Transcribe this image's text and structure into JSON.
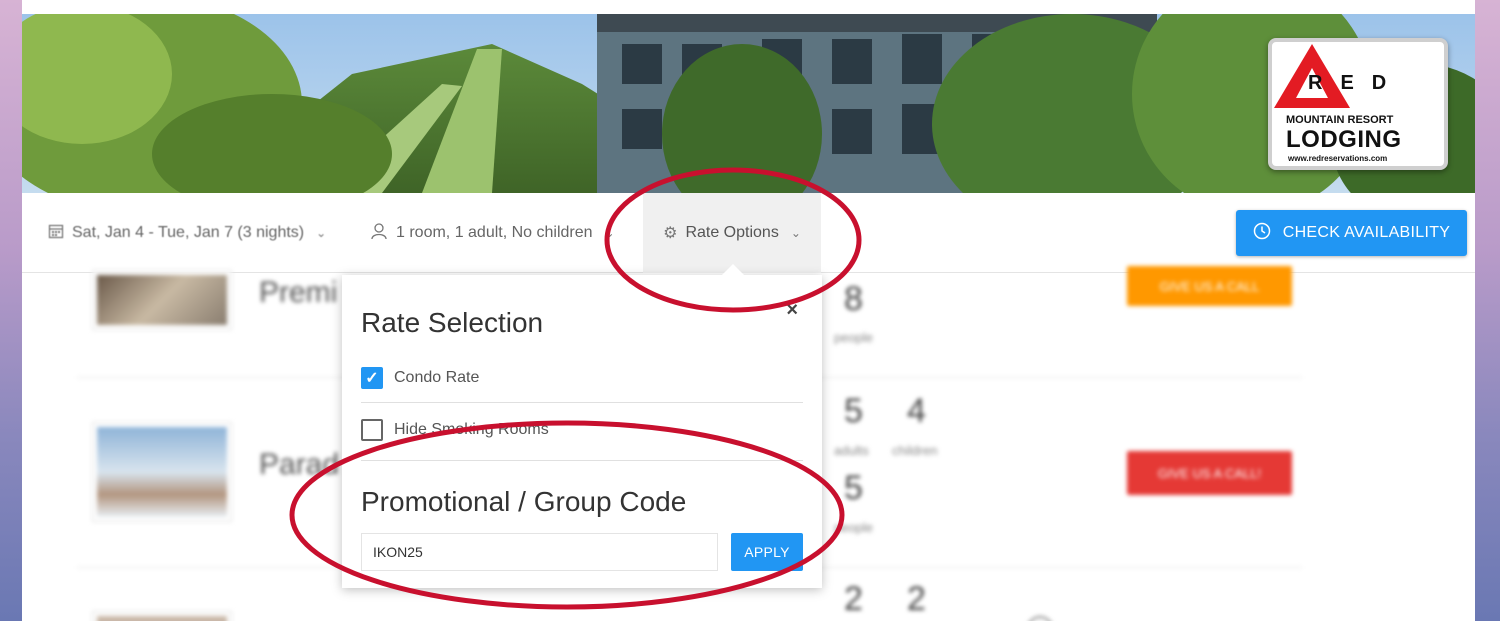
{
  "logo": {
    "letters": "RED",
    "line1": "MOUNTAIN RESORT",
    "line2": "LODGING",
    "line3": "www.redreservations.com"
  },
  "toolbar": {
    "dates_label": "Sat, Jan 4 - Tue, Jan 7 (3 nights)",
    "guests_label": "1 room, 1 adult, No children",
    "rate_options_label": "Rate Options",
    "check_availability_label": "CHECK AVAILABILITY"
  },
  "rooms": [
    {
      "name": "Premi",
      "people_count": "8",
      "people_label": "people",
      "call_label": "GIVE US A CALL"
    },
    {
      "name": "Parad",
      "adults_count": "5",
      "adults_label": "adults",
      "children_count": "4",
      "children_label": "children",
      "people_count": "5",
      "people_label": "people",
      "call_label": "GIVE US A CALL!"
    },
    {
      "adults_count": "2",
      "children_count": "2"
    }
  ],
  "popup": {
    "rate_title": "Rate Selection",
    "close_label": "×",
    "condo_rate_label": "Condo Rate",
    "condo_rate_checked": true,
    "hide_smoking_label": "Hide Smoking Rooms",
    "hide_smoking_checked": false,
    "promo_title": "Promotional / Group Code",
    "promo_value": "IKON25",
    "apply_label": "APPLY"
  },
  "colors": {
    "accent": "#2196f3",
    "call_orange": "#ff9800",
    "call_red": "#e53935",
    "annotation_red": "#c8102e"
  }
}
